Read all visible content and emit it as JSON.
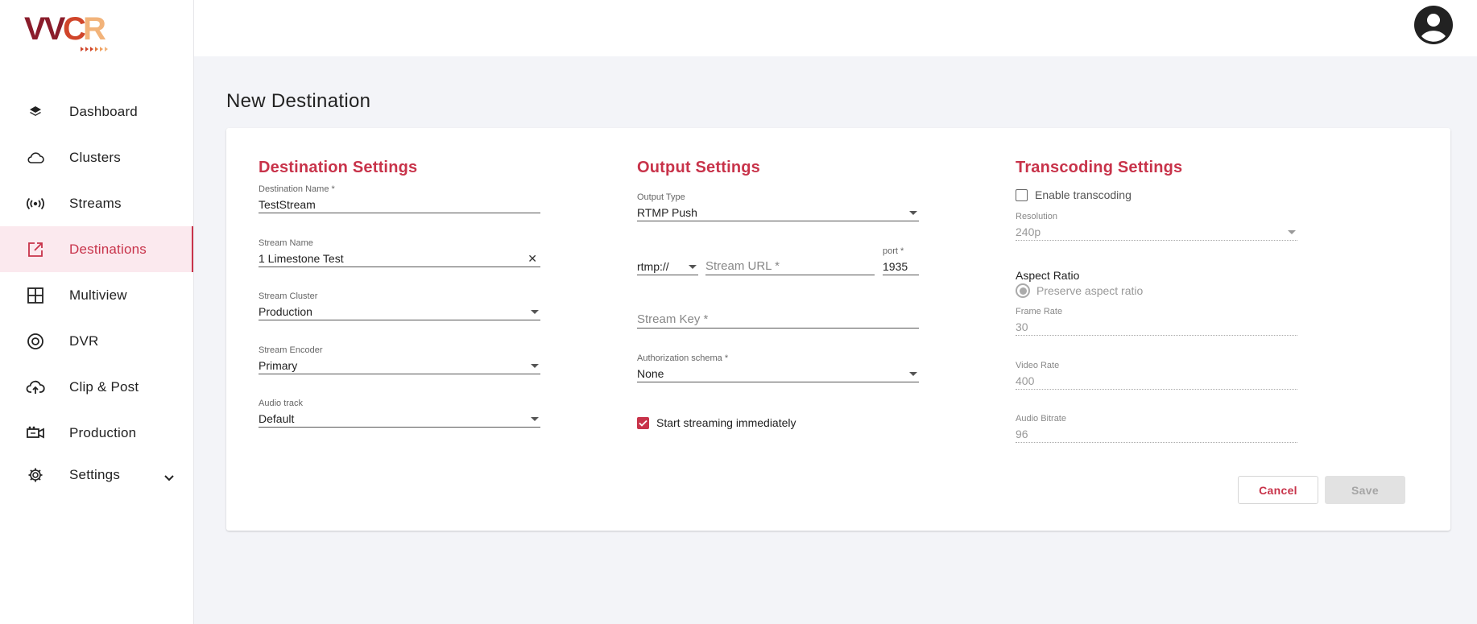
{
  "brand": {
    "logo_text": "VVCR",
    "accent": "#c8334a"
  },
  "nav": {
    "items": [
      {
        "label": "Dashboard",
        "icon": "layers-icon"
      },
      {
        "label": "Clusters",
        "icon": "cloud-icon"
      },
      {
        "label": "Streams",
        "icon": "broadcast-icon"
      },
      {
        "label": "Destinations",
        "icon": "external-link-icon",
        "active": true
      },
      {
        "label": "Multiview",
        "icon": "grid-icon"
      },
      {
        "label": "DVR",
        "icon": "record-icon"
      },
      {
        "label": "Clip & Post",
        "icon": "cloud-upload-icon"
      },
      {
        "label": "Production",
        "icon": "camera-icon"
      },
      {
        "label": "Settings",
        "icon": "gear-icon"
      }
    ]
  },
  "page": {
    "title": "New Destination"
  },
  "destination_settings": {
    "title": "Destination Settings",
    "destination_name": {
      "label": "Destination Name *",
      "value": "TestStream"
    },
    "stream_name": {
      "label": "Stream Name",
      "value": "1 Limestone Test"
    },
    "stream_cluster": {
      "label": "Stream Cluster",
      "value": "Production"
    },
    "stream_encoder": {
      "label": "Stream Encoder",
      "value": "Primary"
    },
    "audio_track": {
      "label": "Audio track",
      "value": "Default"
    }
  },
  "output_settings": {
    "title": "Output Settings",
    "output_type": {
      "label": "Output Type",
      "value": "RTMP Push"
    },
    "protocol": {
      "value": "rtmp://"
    },
    "stream_url": {
      "placeholder": "Stream URL *"
    },
    "port": {
      "label": "port *",
      "value": "1935"
    },
    "stream_key": {
      "placeholder": "Stream Key *"
    },
    "auth_schema": {
      "label": "Authorization schema *",
      "value": "None"
    },
    "start_immediately": {
      "label": "Start streaming immediately",
      "checked": true
    }
  },
  "transcoding_settings": {
    "title": "Transcoding Settings",
    "enable": {
      "label": "Enable transcoding",
      "checked": false
    },
    "resolution": {
      "label": "Resolution",
      "value": "240p"
    },
    "aspect_ratio": {
      "title": "Aspect Ratio",
      "option": "Preserve aspect ratio"
    },
    "frame_rate": {
      "label": "Frame Rate",
      "value": "30"
    },
    "video_rate": {
      "label": "Video Rate",
      "value": "400"
    },
    "audio_bitrate": {
      "label": "Audio Bitrate",
      "value": "96"
    }
  },
  "actions": {
    "cancel": "Cancel",
    "save": "Save"
  }
}
